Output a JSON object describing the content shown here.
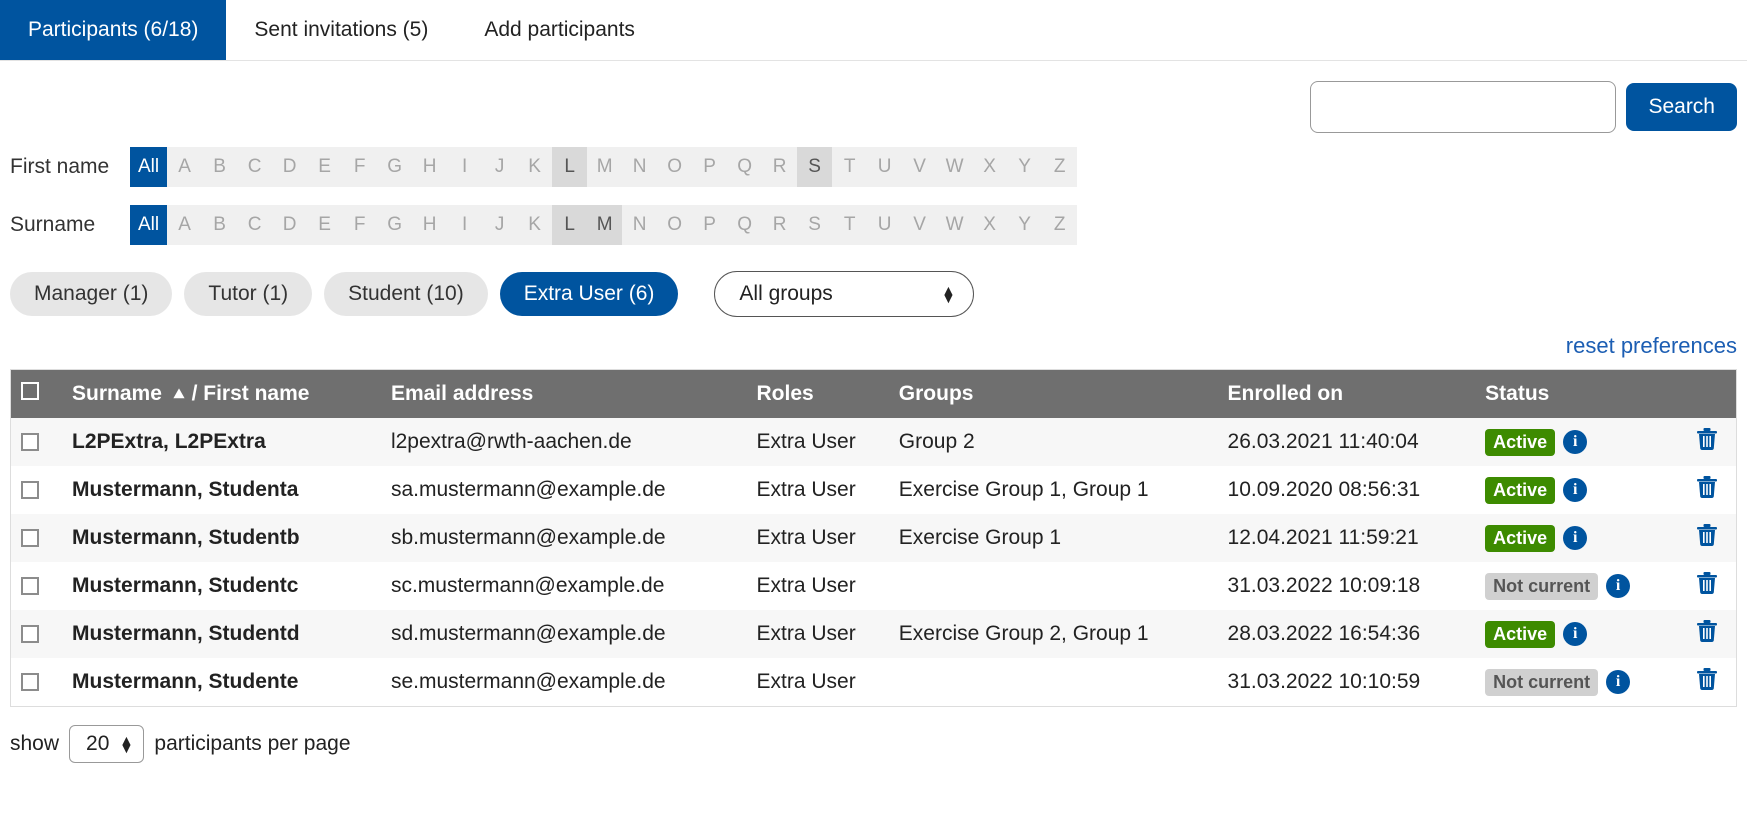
{
  "tabs": [
    {
      "label": "Participants (6/18)",
      "active": true
    },
    {
      "label": "Sent invitations (5)",
      "active": false
    },
    {
      "label": "Add participants",
      "active": false
    }
  ],
  "search": {
    "value": "",
    "button": "Search"
  },
  "filters": {
    "firstname_label": "First name",
    "surname_label": "Surname",
    "all_label": "All",
    "letters": [
      "A",
      "B",
      "C",
      "D",
      "E",
      "F",
      "G",
      "H",
      "I",
      "J",
      "K",
      "L",
      "M",
      "N",
      "O",
      "P",
      "Q",
      "R",
      "S",
      "T",
      "U",
      "V",
      "W",
      "X",
      "Y",
      "Z"
    ],
    "firstname_highlight": [
      "L",
      "S"
    ],
    "surname_highlight": [
      "L",
      "M"
    ]
  },
  "roles": [
    {
      "label": "Manager (1)",
      "active": false
    },
    {
      "label": "Tutor (1)",
      "active": false
    },
    {
      "label": "Student (10)",
      "active": false
    },
    {
      "label": "Extra User (6)",
      "active": true
    }
  ],
  "groups_select": "All groups",
  "reset_label": "reset preferences",
  "table": {
    "headers": {
      "name": "Surname",
      "name_sep": " / ",
      "firstname": "First name",
      "email": "Email address",
      "roles": "Roles",
      "groups": "Groups",
      "enrolled": "Enrolled on",
      "status": "Status"
    },
    "rows": [
      {
        "name": "L2PExtra, L2PExtra",
        "email": "l2pextra@rwth-aachen.de",
        "roles": "Extra User",
        "groups": "Group 2",
        "enrolled": "26.03.2021 11:40:04",
        "status": "Active",
        "status_kind": "active"
      },
      {
        "name": "Mustermann, Studenta",
        "email": "sa.mustermann@example.de",
        "roles": "Extra User",
        "groups": "Exercise Group 1, Group 1",
        "enrolled": "10.09.2020 08:56:31",
        "status": "Active",
        "status_kind": "active"
      },
      {
        "name": "Mustermann, Studentb",
        "email": "sb.mustermann@example.de",
        "roles": "Extra User",
        "groups": "Exercise Group 1",
        "enrolled": "12.04.2021 11:59:21",
        "status": "Active",
        "status_kind": "active"
      },
      {
        "name": "Mustermann, Studentc",
        "email": "sc.mustermann@example.de",
        "roles": "Extra User",
        "groups": "",
        "enrolled": "31.03.2022 10:09:18",
        "status": "Not current",
        "status_kind": "notcurrent"
      },
      {
        "name": "Mustermann, Studentd",
        "email": "sd.mustermann@example.de",
        "roles": "Extra User",
        "groups": "Exercise Group 2, Group 1",
        "enrolled": "28.03.2022 16:54:36",
        "status": "Active",
        "status_kind": "active"
      },
      {
        "name": "Mustermann, Studente",
        "email": "se.mustermann@example.de",
        "roles": "Extra User",
        "groups": "",
        "enrolled": "31.03.2022 10:10:59",
        "status": "Not current",
        "status_kind": "notcurrent"
      }
    ]
  },
  "pager": {
    "show": "show",
    "value": "20",
    "suffix": "participants per page"
  }
}
